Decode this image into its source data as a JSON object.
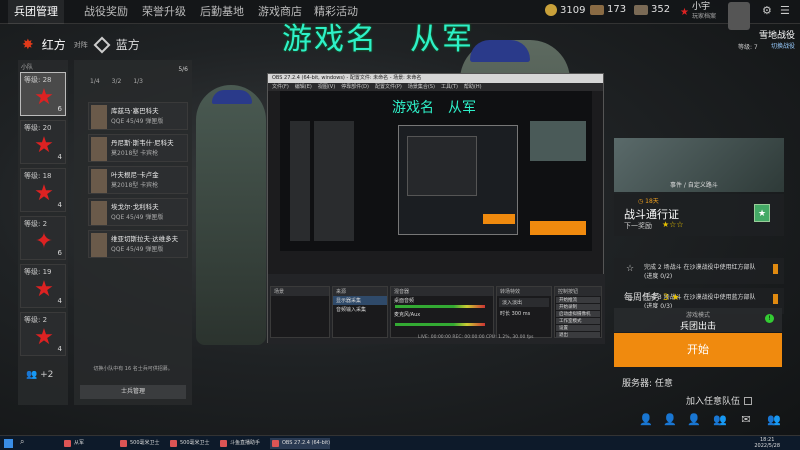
{
  "topbar": {
    "tabs": [
      "兵团管理",
      "战役奖励",
      "荣誉升级",
      "后勤基地",
      "游戏商店",
      "精彩活动"
    ],
    "resources": {
      "silver": "3109",
      "ticket_a": "173",
      "ticket_b": "352"
    },
    "player": {
      "name": "小宇",
      "subtitle": "玩家档案",
      "level_label": "等级: 7"
    },
    "campaign": {
      "title": "雪地战役",
      "switch": "切换战役"
    }
  },
  "overlay_title": "游戏名　从军",
  "faction": {
    "red": "红方",
    "vs": "对阵",
    "blue": "蓝方"
  },
  "sidebar": {
    "header": "小队",
    "count": "5/6",
    "squads": [
      {
        "level": "等级: 28",
        "count": "6"
      },
      {
        "level": "等级: 20",
        "count": "4"
      },
      {
        "level": "等级: 18",
        "count": "4"
      },
      {
        "level": "等级: 2",
        "count": "6"
      },
      {
        "level": "等级: 19",
        "count": "4"
      },
      {
        "level": "等级: 2",
        "count": "4"
      }
    ],
    "more": "+2"
  },
  "roster": {
    "header": "士兵管理",
    "stats": [
      "1/4",
      "3/2",
      "1/3"
    ],
    "soldiers": [
      {
        "name": "库兹马·塞巴科夫",
        "weapon": "QQE 45/49 弹匣版"
      },
      {
        "name": "丹尼斯·斯韦什·尼科夫",
        "weapon": "莫2018型 卡宾枪"
      },
      {
        "name": "叶夫根尼·卡卢金",
        "weapon": "莫2018型 卡宾枪"
      },
      {
        "name": "埃戈尔·戈利科夫",
        "weapon": "QQE 45/49 弹匣版"
      },
      {
        "name": "维亚切斯拉夫·达维多夫",
        "weapon": "QQE 45/49 弹匣版"
      }
    ],
    "hint": "切换小队中有 16 名士兵可供招募。",
    "manage_btn": "士兵管理"
  },
  "obs": {
    "title": "OBS 27.2.4 (64-bit, windows) - 配置文件: 未命名 - 场景: 未命名",
    "menu": [
      "文件(F)",
      "编辑(E)",
      "视图(V)",
      "停靠部件(D)",
      "配置文件(P)",
      "场景集合(S)",
      "工具(T)",
      "帮助(H)"
    ],
    "inner_title": "游戏名　从军",
    "docks": {
      "scenes": "场景",
      "sources": "来源",
      "mixer": "混音器",
      "transitions": "转场特效",
      "controls": "控制按钮"
    },
    "sources": [
      "显示器采集",
      "音频输入采集"
    ],
    "mixer": [
      {
        "name": "桌面音频",
        "db": "0.0 dB"
      },
      {
        "name": "麦克风/Aux",
        "db": "0.0 dB"
      }
    ],
    "transition": {
      "name": "淡入淡出",
      "duration_label": "时长",
      "duration": "300 ms"
    },
    "controls": [
      "开始推流",
      "开始录制",
      "启动虚拟摄像机",
      "工作室模式",
      "设置",
      "退出"
    ],
    "status": "LIVE: 00:00:00  REC: 00:00:00  CPU: 1.2%, 30.00 fps"
  },
  "pass": {
    "event": "事件 / 自定义路斗",
    "days": "18天",
    "title": "战斗通行证",
    "next_reward": "下一奖励",
    "missions": [
      {
        "text": "完成 2 场战斗 在沙漠战役中使用红方部队 (进度 0/2)"
      },
      {
        "text": "完成 3 场战斗 在沙漠战役中使用蓝方部队 (进度 0/3)"
      }
    ],
    "weekly": "每周任务",
    "weekly_stars": "3"
  },
  "mode": {
    "label": "游戏模式",
    "value": "兵团出击"
  },
  "start_label": "开始",
  "server_label": "服务器: 任意",
  "random_squad_label": "加入任意队伍",
  "taskbar": {
    "items": [
      "从军",
      "500毫米卫士",
      "500毫米卫士",
      "斗鱼直播助手",
      "OBS 27.2.4 (64-bit)"
    ],
    "clock": "18:21",
    "date": "2022/5/28"
  }
}
